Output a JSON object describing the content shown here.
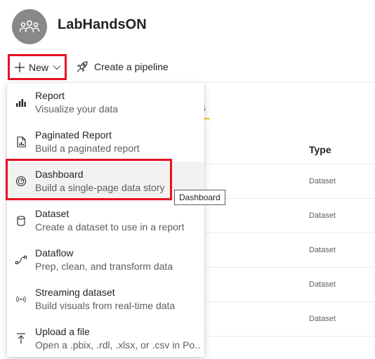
{
  "workspace": {
    "title": "LabHandsON",
    "avatar_icon": "people-group-icon"
  },
  "toolbar": {
    "new_label": "New",
    "new_icon": "plus-icon",
    "chevron_icon": "chevron-down-icon",
    "pipeline_label": "Create a pipeline",
    "pipeline_icon": "rocket-icon"
  },
  "table": {
    "type_header": "Type",
    "rows": [
      "Dataset",
      "Dataset",
      "Dataset",
      "Dataset",
      "Dataset"
    ]
  },
  "tab_fragment": "s",
  "new_menu": {
    "items": [
      {
        "title": "Report",
        "description": "Visualize your data",
        "icon": "bar-chart-icon"
      },
      {
        "title": "Paginated Report",
        "description": "Build a paginated report",
        "icon": "paginated-report-icon"
      },
      {
        "title": "Dashboard",
        "description": "Build a single-page data story",
        "icon": "gauge-icon"
      },
      {
        "title": "Dataset",
        "description": "Create a dataset to use in a report",
        "icon": "database-icon"
      },
      {
        "title": "Dataflow",
        "description": "Prep, clean, and transform data",
        "icon": "dataflow-icon"
      },
      {
        "title": "Streaming dataset",
        "description": "Build visuals from real-time data",
        "icon": "streaming-icon"
      },
      {
        "title": "Upload a file",
        "description": "Open a .pbix, .rdl, .xlsx, or .csv in Po...",
        "icon": "upload-icon"
      }
    ]
  },
  "tooltip": "Dashboard",
  "colors": {
    "highlight_border": "#e81123",
    "tab_accent": "#f2c811",
    "avatar_bg": "#8a8886"
  }
}
